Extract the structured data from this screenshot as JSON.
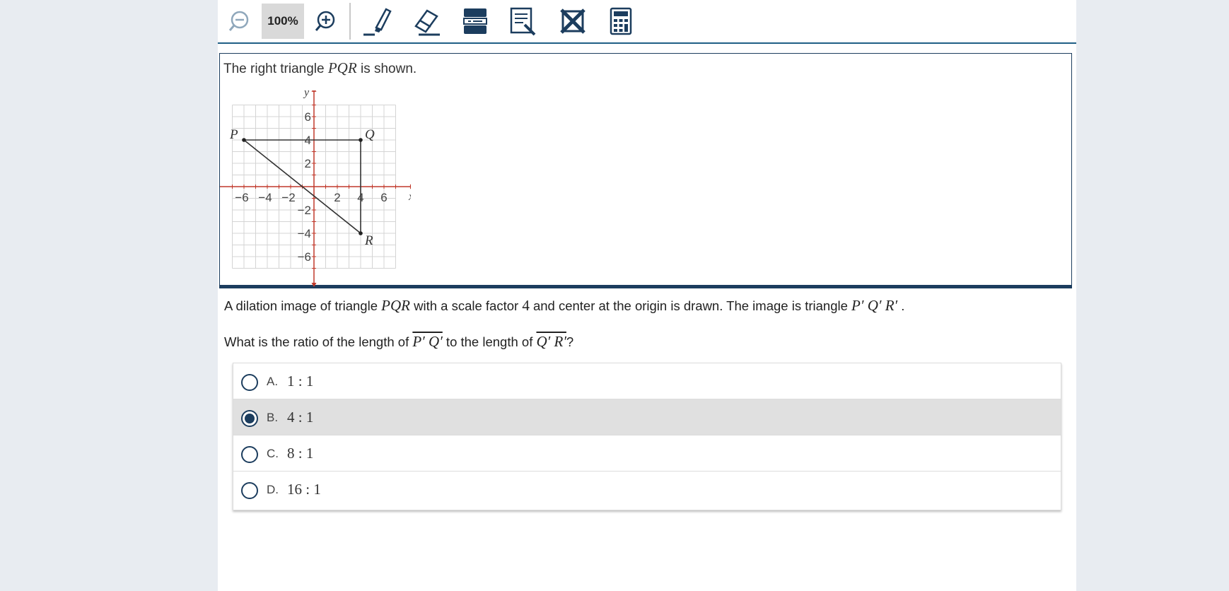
{
  "toolbar": {
    "zoom_out_icon": "zoom-out-icon",
    "zoom_level": "100%",
    "zoom_in_icon": "zoom-in-icon",
    "tools": [
      "highlighter-icon",
      "eraser-icon",
      "line-reader-icon",
      "notepad-icon",
      "answer-eliminator-icon",
      "calculator-icon"
    ]
  },
  "stimulus": {
    "text_before": "The right triangle ",
    "triangle_name": "PQR",
    "text_after": " is shown.",
    "graph": {
      "x_label": "x",
      "y_label": "y",
      "x_ticks": [
        "−6",
        "−4",
        "−2",
        "2",
        "4",
        "6"
      ],
      "y_ticks": [
        "6",
        "4",
        "2",
        "−2",
        "−4",
        "−6"
      ],
      "points": [
        {
          "label": "P",
          "x": -6,
          "y": 4
        },
        {
          "label": "Q",
          "x": 4,
          "y": 4
        },
        {
          "label": "R",
          "x": 4,
          "y": -4
        }
      ]
    }
  },
  "question": {
    "line1_a": "A dilation image of triangle ",
    "line1_tri": "PQR",
    "line1_b": " with a scale factor ",
    "line1_scale": "4",
    "line1_c": " and center at the origin is drawn. The image is triangle ",
    "line1_image": "P′ Q′ R′",
    "line1_end": " .",
    "line2_a": "What is the ratio of the length of ",
    "line2_seg1": "P′ Q′",
    "line2_b": " to the length of ",
    "line2_seg2": "Q′ R′",
    "line2_end": "?"
  },
  "options": [
    {
      "letter": "A.",
      "value": "1 : 1",
      "selected": false
    },
    {
      "letter": "B.",
      "value": "4 : 1",
      "selected": true
    },
    {
      "letter": "C.",
      "value": "8 : 1",
      "selected": false
    },
    {
      "letter": "D.",
      "value": "16 : 1",
      "selected": false
    }
  ],
  "colors": {
    "accent": "#1c3d5e",
    "axis": "#c0392b",
    "grid": "#d4d4d4",
    "selected_bg": "#e0e0e0"
  }
}
